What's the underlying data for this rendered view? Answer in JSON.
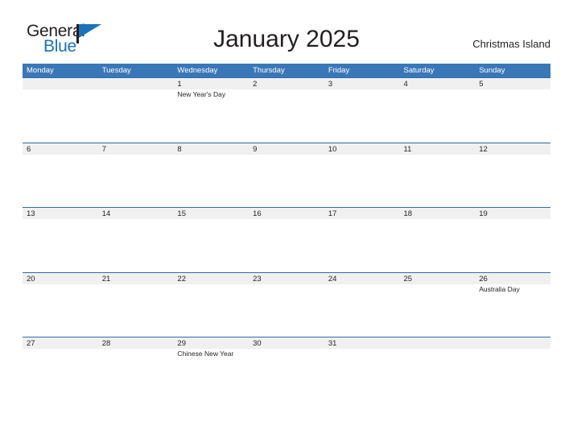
{
  "brand": {
    "name_part1": "General",
    "name_part2": "Blue",
    "icon": "flag-icon",
    "color_dark": "#231f20",
    "color_blue": "#1a72b8"
  },
  "header": {
    "title": "January 2025",
    "location": "Christmas Island"
  },
  "theme": {
    "header_bg": "#3a77b8",
    "band_bg": "#f0f0f0",
    "rule": "#2f6ca8",
    "text": "#231f20",
    "header_text": "#ffffff"
  },
  "calendar": {
    "month": "January",
    "year": "2025",
    "weekday_headers": [
      "Monday",
      "Tuesday",
      "Wednesday",
      "Thursday",
      "Friday",
      "Saturday",
      "Sunday"
    ],
    "weeks": [
      [
        {
          "date": "",
          "event": ""
        },
        {
          "date": "",
          "event": ""
        },
        {
          "date": "1",
          "event": "New Year's Day"
        },
        {
          "date": "2",
          "event": ""
        },
        {
          "date": "3",
          "event": ""
        },
        {
          "date": "4",
          "event": ""
        },
        {
          "date": "5",
          "event": ""
        }
      ],
      [
        {
          "date": "6",
          "event": ""
        },
        {
          "date": "7",
          "event": ""
        },
        {
          "date": "8",
          "event": ""
        },
        {
          "date": "9",
          "event": ""
        },
        {
          "date": "10",
          "event": ""
        },
        {
          "date": "11",
          "event": ""
        },
        {
          "date": "12",
          "event": ""
        }
      ],
      [
        {
          "date": "13",
          "event": ""
        },
        {
          "date": "14",
          "event": ""
        },
        {
          "date": "15",
          "event": ""
        },
        {
          "date": "16",
          "event": ""
        },
        {
          "date": "17",
          "event": ""
        },
        {
          "date": "18",
          "event": ""
        },
        {
          "date": "19",
          "event": ""
        }
      ],
      [
        {
          "date": "20",
          "event": ""
        },
        {
          "date": "21",
          "event": ""
        },
        {
          "date": "22",
          "event": ""
        },
        {
          "date": "23",
          "event": ""
        },
        {
          "date": "24",
          "event": ""
        },
        {
          "date": "25",
          "event": ""
        },
        {
          "date": "26",
          "event": "Australia Day"
        }
      ],
      [
        {
          "date": "27",
          "event": ""
        },
        {
          "date": "28",
          "event": ""
        },
        {
          "date": "29",
          "event": "Chinese New Year"
        },
        {
          "date": "30",
          "event": ""
        },
        {
          "date": "31",
          "event": ""
        },
        {
          "date": "",
          "event": ""
        },
        {
          "date": "",
          "event": ""
        }
      ]
    ]
  }
}
